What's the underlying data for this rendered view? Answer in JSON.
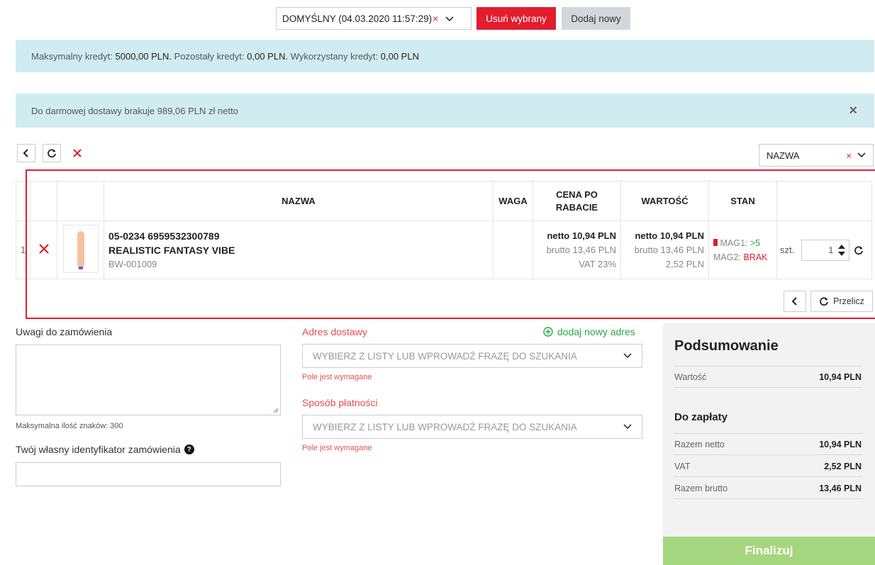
{
  "cart_selector": {
    "value": "DOMYŚLNY (04.03.2020 11:57:29)"
  },
  "buttons": {
    "delete_selected": "Usuń wybrany",
    "add_new": "Dodaj nowy",
    "recalculate": "Przelicz",
    "finalize": "Finalizuj"
  },
  "credit": {
    "max_label": "Maksymalny kredyt:",
    "max_value": "5000,00 PLN.",
    "remaining_label": "Pozostały kredyt:",
    "remaining_value": "0,00 PLN.",
    "used_label": "Wykorzystany kredyt:",
    "used_value": "0,00 PLN"
  },
  "free_shipping": "Do darmowej dostawy brakuje 989,06 PLN zł netto",
  "sort": {
    "value": "NAZWA"
  },
  "table": {
    "headers": {
      "name": "NAZWA",
      "weight": "WAGA",
      "price": "CENA PO RABACIE",
      "value": "WARTOŚĆ",
      "stock": "STAN"
    },
    "rows": [
      {
        "index": "1",
        "code": "05-0234 6959532300789",
        "name": "REALISTIC FANTASY VIBE",
        "sku": "BW-001009",
        "price_net": "netto 10,94 PLN",
        "price_gross": "brutto 13,46 PLN",
        "vat_rate": "VAT 23%",
        "value_net": "netto 10,94 PLN",
        "value_gross": "brutto 13,46 PLN",
        "value_vat": "2,52 PLN",
        "stock_mag1_label": "MAG1:",
        "stock_mag1_value": ">5",
        "stock_mag2_label": "MAG2:",
        "stock_mag2_value": "BRAK",
        "qty_unit": "szt.",
        "qty": "1"
      }
    ]
  },
  "notes": {
    "label": "Uwagi do zamówienia",
    "hint": "Maksymalna ilość znaków: 300"
  },
  "own_id": {
    "label": "Twój własny identyfikator zamówienia"
  },
  "delivery": {
    "label": "Adres dostawy",
    "add_link": "dodaj nowy adres",
    "placeholder": "WYBIERZ Z LISTY LUB WPROWADŹ FRAZĘ DO SZUKANIA",
    "error": "Pole jest wymagane"
  },
  "payment": {
    "label": "Sposób płatności",
    "placeholder": "WYBIERZ Z LISTY LUB WPROWADŹ FRAZĘ DO SZUKANIA",
    "error": "Pole jest wymagane"
  },
  "summary": {
    "title": "Podsumowanie",
    "value_label": "Wartość",
    "value": "10,94 PLN",
    "to_pay_title": "Do zapłaty",
    "net_label": "Razem netto",
    "net": "10,94 PLN",
    "vat_label": "VAT",
    "vat": "2,52 PLN",
    "gross_label": "Razem brutto",
    "gross": "13,46 PLN"
  },
  "colors": {
    "primary_red": "#e21d2e",
    "info_bg": "#d1ecf1",
    "finalize_green": "#a6d57f",
    "stock_ok": "#28a745"
  }
}
